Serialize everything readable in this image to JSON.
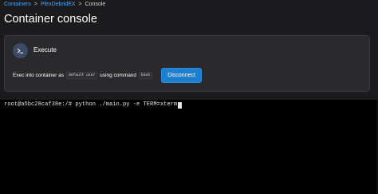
{
  "breadcrumb": {
    "items": [
      "Containers",
      "PlexDebridEX"
    ],
    "separator": ">",
    "current": "Console"
  },
  "page": {
    "title": "Container console"
  },
  "execute_panel": {
    "header": "Execute",
    "icon": "terminal-icon",
    "exec_prefix": "Exec into container as",
    "user_value": "default user",
    "command_label": "using command",
    "command_value": "bash",
    "disconnect_label": "Disconnect"
  },
  "terminal": {
    "prompt": "root@a5bc28caf38e:/# ",
    "command": "python ./main.py -e TERM=xterm"
  },
  "colors": {
    "background": "#1b1b1d",
    "panel": "#2a2a2d",
    "link": "#4ea3f5",
    "primary_button": "#1d7fd0",
    "terminal_bg": "#000000"
  }
}
